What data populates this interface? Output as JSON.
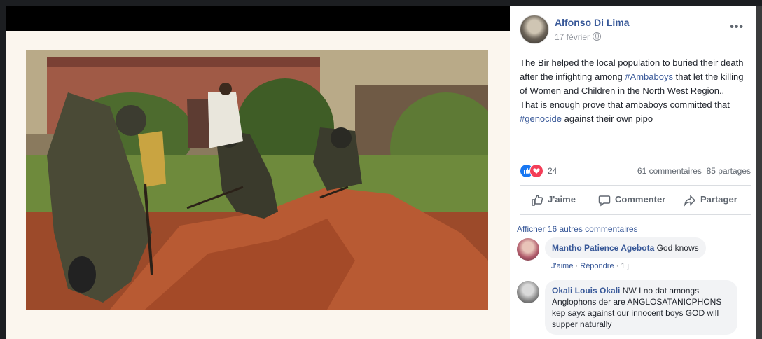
{
  "post": {
    "author": "Alfonso Di Lima",
    "date": "17 février",
    "more_label": "•••",
    "text_1": "The Bir helped the local population to buried their death after the infighting among ",
    "hashtag_1": "#Ambaboys",
    "text_2": " that let the killing of Women and Children in the North West Region..\nThat is enough prove that ambaboys committed that ",
    "hashtag_2": "#genocide",
    "text_3": " against their own pipo"
  },
  "reactions": {
    "count": "24",
    "comments": "61 commentaires",
    "shares": "85 partages"
  },
  "actions": {
    "like": "J'aime",
    "comment": "Commenter",
    "share": "Partager"
  },
  "comments": {
    "show_more": "Afficher 16 autres commentaires",
    "items": [
      {
        "name": "Mantho Patience Agebota",
        "text": "God knows",
        "like": "J'aime",
        "reply": "Répondre",
        "time": "1 j"
      },
      {
        "name": "Okali Louis Okali",
        "text": "NW I no dat amongs Anglophons der are ANGLOSATANICPHONS kep sayx against our innocent boys GOD will supper naturally"
      }
    ]
  },
  "colors": {
    "link": "#385898",
    "like_blue": "#1877f2",
    "love_red": "#f33e58"
  }
}
